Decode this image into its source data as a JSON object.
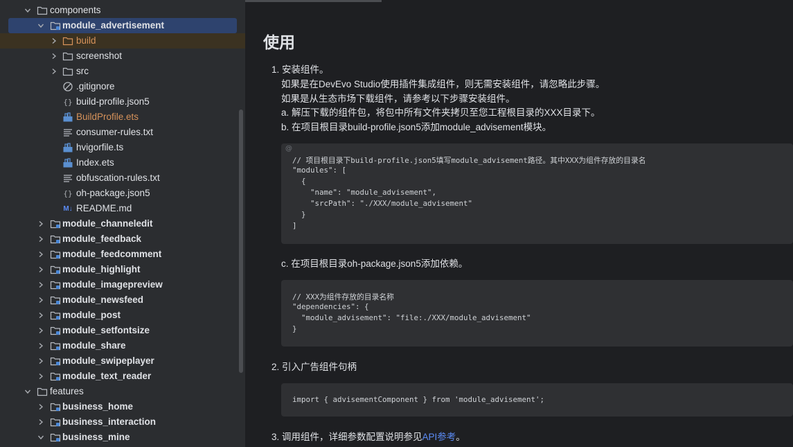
{
  "tree": {
    "items": [
      {
        "label": "components"
      },
      {
        "label": "module_advertisement"
      },
      {
        "label": "build"
      },
      {
        "label": "screenshot"
      },
      {
        "label": "src"
      },
      {
        "label": ".gitignore"
      },
      {
        "label": "build-profile.json5"
      },
      {
        "label": "BuildProfile.ets"
      },
      {
        "label": "consumer-rules.txt"
      },
      {
        "label": "hvigorfile.ts"
      },
      {
        "label": "Index.ets"
      },
      {
        "label": "obfuscation-rules.txt"
      },
      {
        "label": "oh-package.json5"
      },
      {
        "label": "README.md"
      },
      {
        "label": "module_channeledit"
      },
      {
        "label": "module_feedback"
      },
      {
        "label": "module_feedcomment"
      },
      {
        "label": "module_highlight"
      },
      {
        "label": "module_imagepreview"
      },
      {
        "label": "module_newsfeed"
      },
      {
        "label": "module_post"
      },
      {
        "label": "module_setfontsize"
      },
      {
        "label": "module_share"
      },
      {
        "label": "module_swipeplayer"
      },
      {
        "label": "module_text_reader"
      },
      {
        "label": "features"
      },
      {
        "label": "business_home"
      },
      {
        "label": "business_interaction"
      },
      {
        "label": "business_mine"
      }
    ],
    "md_badge": "M↓",
    "json_badge": "{}"
  },
  "doc": {
    "title": "使用",
    "step1": "1. 安装组件。",
    "step1_l1": "如果是在DevEvo Studio使用插件集成组件，则无需安装组件，请忽略此步骤。",
    "step1_l2": "如果是从生态市场下载组件，请参考以下步骤安装组件。",
    "step1_a": "a. 解压下载的组件包，将包中所有文件夹拷贝至您工程根目录的XXX目录下。",
    "step1_b": "b. 在项目根目录build-profile.json5添加module_advisement模块。",
    "code1_at": "@",
    "code1": [
      "// 项目根目录下build-profile.json5填写module_advisement路径。其中XXX为组件存放的目录名",
      "\"modules\": [",
      "  {",
      "    \"name\": \"module_advisement\",",
      "    \"srcPath\": \"./XXX/module_advisement\"",
      "  }",
      "]"
    ],
    "step1_c": "c. 在项目根目录oh-package.json5添加依赖。",
    "code2": [
      "// XXX为组件存放的目录名称",
      "\"dependencies\": {",
      "  \"module_advisement\": \"file:./XXX/module_advisement\"",
      "}"
    ],
    "step2": "2. 引入广告组件句柄",
    "code3": [
      "import { advisementComponent } from 'module_advisement';"
    ],
    "step3_pre": "3. 调用组件，详细参数配置说明参见",
    "step3_link": "API参考",
    "step3_post": "。"
  },
  "colors": {
    "tree_bg": "#2b2d30",
    "doc_bg": "#1e1f22",
    "selection": "#2e436e",
    "accent_orange": "#d6925a",
    "link": "#5b8bf5",
    "code_bg": "#2f3033"
  }
}
